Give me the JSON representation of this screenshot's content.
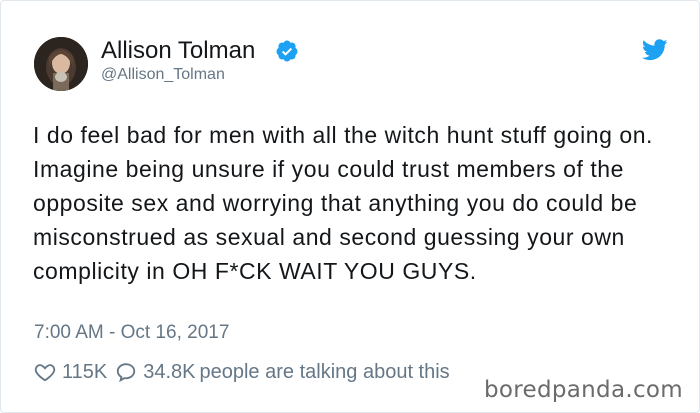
{
  "author": {
    "name": "Allison Tolman",
    "handle": "@Allison_Tolman",
    "verified": true,
    "avatar_icon": "profile-photo"
  },
  "tweet": {
    "text": "I do feel bad for men with all the witch hunt stuff going on. Imagine being unsure if you could trust members of the opposite sex and worrying that anything you do could be misconstrued as sexual and second guessing your own complicity in OH F*CK WAIT YOU GUYS.",
    "timestamp": "7:00 AM - Oct 16, 2017"
  },
  "stats": {
    "likes": "115K",
    "replies": "34.8K",
    "talking_label": "people are talking about this"
  },
  "watermark": "boredpanda.com",
  "icons": {
    "verified": "verified-badge-icon",
    "brand": "twitter-bird-icon",
    "like": "heart-icon",
    "reply": "speech-bubble-icon"
  },
  "colors": {
    "twitter_blue": "#1da1f2",
    "text": "#14171a",
    "secondary": "#657786",
    "border": "#e1e8ed"
  }
}
